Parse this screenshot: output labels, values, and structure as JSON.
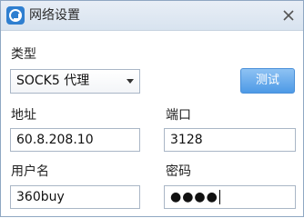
{
  "window": {
    "title": "网络设置",
    "app_icon": "network-settings-icon",
    "close_icon": "close-icon"
  },
  "form": {
    "type_label": "类型",
    "type_value": "SOCK5 代理",
    "test_button": "测试",
    "address_label": "地址",
    "address_value": "60.8.208.10",
    "port_label": "端口",
    "port_value": "3128",
    "username_label": "用户名",
    "username_value": "360buy",
    "password_label": "密码",
    "password_masked": "●●●●"
  },
  "colors": {
    "accent": "#4d9ae6",
    "title_bar": "#dfe8f2",
    "field_border": "#a9b6c6"
  }
}
